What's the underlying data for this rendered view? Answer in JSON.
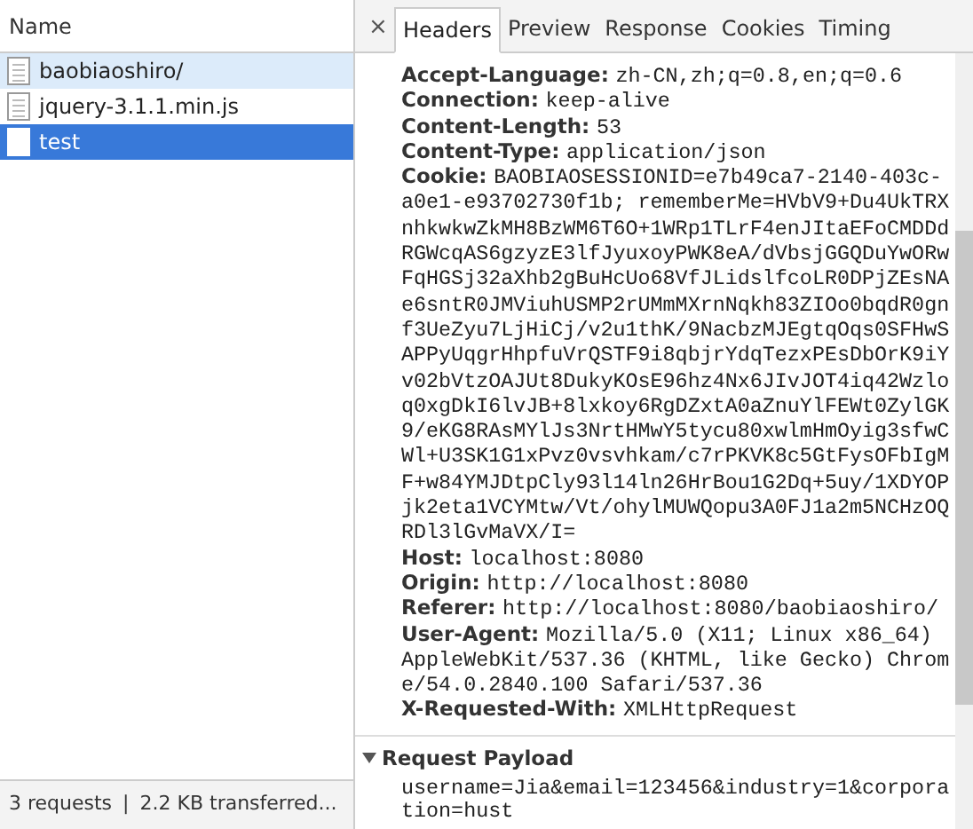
{
  "requests_panel": {
    "column_header": "Name",
    "items": [
      {
        "name": "baobiaoshiro/",
        "selected": false,
        "hovered": true
      },
      {
        "name": "jquery-3.1.1.min.js",
        "selected": false,
        "hovered": false
      },
      {
        "name": "test",
        "selected": true,
        "hovered": false
      }
    ],
    "status_bar": {
      "requests": "3 requests",
      "separator": "|",
      "transferred": "2.2 KB transferred..."
    }
  },
  "detail_panel": {
    "close": "×",
    "tabs": [
      {
        "label": "Headers",
        "selected": true
      },
      {
        "label": "Preview",
        "selected": false
      },
      {
        "label": "Response",
        "selected": false
      },
      {
        "label": "Cookies",
        "selected": false
      },
      {
        "label": "Timing",
        "selected": false
      }
    ],
    "headers": [
      {
        "name": "Accept-Language:",
        "value": "zh-CN,zh;q=0.8,en;q=0.6"
      },
      {
        "name": "Connection:",
        "value": "keep-alive"
      },
      {
        "name": "Content-Length:",
        "value": "53"
      },
      {
        "name": "Content-Type:",
        "value": "application/json"
      },
      {
        "name": "Cookie:",
        "value": "BAOBIAOSESSIONID=e7b49ca7-2140-403c-a0e1-e93702730f1b; rememberMe=HVbV9+Du4UkTRXnhkwkwZkMH8BzWM6T6O+1WRp1TLrF4enJItaEFoCMDDdRGWcqAS6gzyzE3lfJyuxoyPWK8eA/dVbsjGGQDuYwORwFqHGSj32aXhb2gBuHcUo68VfJLidslfcoLR0DPjZEsNAe6sntR0JMViuhUSMP2rUMmMXrnNqkh83ZIOo0bqdR0gnf3UeZyu7LjHiCj/v2u1thK/9NacbzMJEgtqOqs0SFHwSAPPyUqgrHhpfuVrQSTF9i8qbjrYdqTezxPEsDbOrK9iYv02bVtzOAJUt8DukyKOsE96hz4Nx6JIvJOT4iq42Wzloq0xgDkI6lvJB+8lxkoy6RgDZxtA0aZnuYlFEWt0ZylGK9/eKG8RAsMYlJs3NrtHMwY5tycu80xwlmHmOyig3sfwCWl+U3SK1G1xPvz0vsvhkam/c7rPKVK8c5GtFysOFbIgMF+w84YMJDtpCly93l14ln26HrBou1G2Dq+5uy/1XDYOPjk2eta1VCYMtw/Vt/ohylMUWQopu3A0FJ1a2m5NCHzOQRDl3lGvMaVX/I="
      },
      {
        "name": "Host:",
        "value": "localhost:8080"
      },
      {
        "name": "Origin:",
        "value": "http://localhost:8080"
      },
      {
        "name": "Referer:",
        "value": "http://localhost:8080/baobiaoshiro/"
      },
      {
        "name": "User-Agent:",
        "value": "Mozilla/5.0 (X11; Linux x86_64) AppleWebKit/537.36 (KHTML, like Gecko) Chrome/54.0.2840.100 Safari/537.36"
      },
      {
        "name": "X-Requested-With:",
        "value": "XMLHttpRequest"
      }
    ],
    "payload_section": {
      "title": "Request Payload",
      "expanded": true,
      "body": "username=Jia&email=123456&industry=1&corporation=hust"
    }
  }
}
